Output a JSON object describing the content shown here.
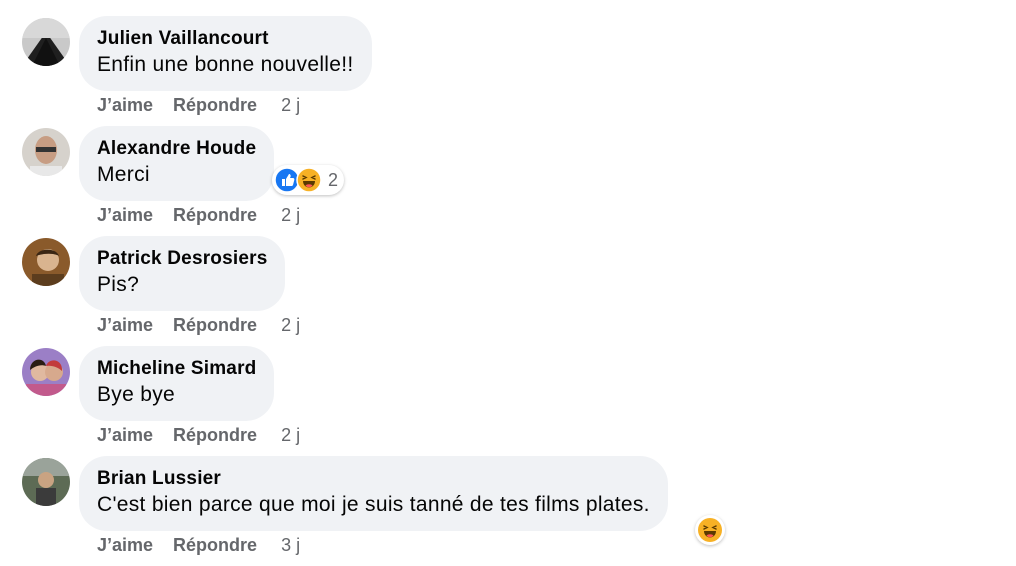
{
  "comments": [
    {
      "author": "Julien Vaillancourt",
      "text": "Enfin une bonne nouvelle!!",
      "like_label": "J’aime",
      "reply_label": "Répondre",
      "time": "2 j"
    },
    {
      "author": "Alexandre Houde",
      "text": "Merci",
      "like_label": "J’aime",
      "reply_label": "Répondre",
      "time": "2 j",
      "reactions": {
        "icons": [
          "like-icon",
          "haha-icon"
        ],
        "count": "2"
      }
    },
    {
      "author": "Patrick Desrosiers",
      "text": "Pis?",
      "like_label": "J’aime",
      "reply_label": "Répondre",
      "time": "2 j"
    },
    {
      "author": "Micheline Simard",
      "text": "Bye bye",
      "like_label": "J’aime",
      "reply_label": "Répondre",
      "time": "2 j"
    },
    {
      "author": "Brian Lussier",
      "text": "C'est bien parce que moi je suis tanné de tes films plates.",
      "like_label": "J’aime",
      "reply_label": "Répondre",
      "time": "3 j",
      "reactions": {
        "icons": [
          "haha-icon"
        ]
      }
    }
  ],
  "colors": {
    "bubble": "#f0f2f5",
    "meta": "#65676b",
    "like_blue": "#1877f2",
    "haha_yellow": "#f7b125"
  }
}
